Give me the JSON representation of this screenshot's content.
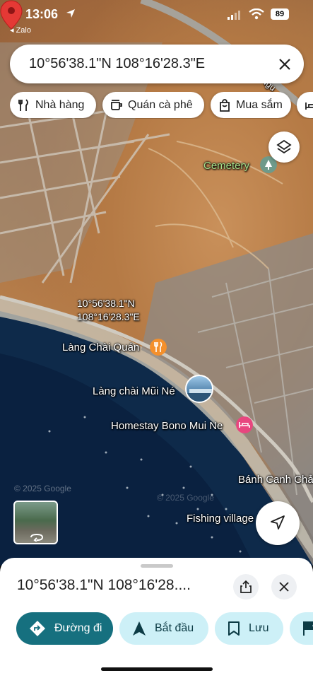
{
  "status_bar": {
    "time": "13:06",
    "back_app": "◂ Zalo",
    "battery": "89"
  },
  "search": {
    "value": "10°56'38.1\"N 108°16'28.3\"E"
  },
  "chips": [
    {
      "label": "Nhà hàng",
      "icon": "restaurant-icon"
    },
    {
      "label": "Quán cà phê",
      "icon": "coffee-icon"
    },
    {
      "label": "Mua sắm",
      "icon": "shopping-bag-icon"
    }
  ],
  "map": {
    "road_label": "Ngu",
    "pin_label_line1": "10°56'38.1\"N",
    "pin_label_line2": "108°16'28.3\"E",
    "places": {
      "cemetery": "Cemetery",
      "lang_chai_quan": "Làng Chài Quán",
      "lang_chai_mui_ne": "Làng chài Mũi Né",
      "homestay": "Homestay Bono Mui Ne",
      "banh_canh": "Bánh Canh Chả",
      "fishing_village": "Fishing village"
    },
    "watermark": "© 2025 Google",
    "watermark2": "© 2025 Google"
  },
  "sheet": {
    "title": "10°56'38.1\"N 108°16'28....",
    "actions": [
      {
        "label": "Đường đi",
        "icon": "directions-icon",
        "style": "primary"
      },
      {
        "label": "Bắt đầu",
        "icon": "navigation-arrow-icon",
        "style": "secondary"
      },
      {
        "label": "Lưu",
        "icon": "bookmark-icon",
        "style": "secondary"
      }
    ]
  },
  "colors": {
    "primary_action": "#16707f",
    "secondary_action": "#cdf0f7",
    "pin": "#e53935",
    "restaurant_poi": "#f4902c",
    "hotel_poi": "#e8467f"
  }
}
